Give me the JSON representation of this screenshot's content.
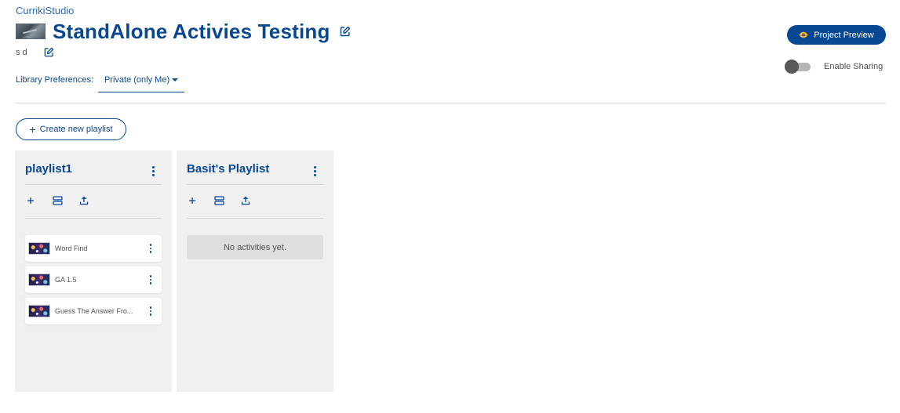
{
  "breadcrumb": "CurrikiStudio",
  "project": {
    "title": "StandAlone Activies Testing",
    "description": "s d"
  },
  "library": {
    "label": "Library Preferences:",
    "selected": "Private (only Me)"
  },
  "preview_button": {
    "label": "Project Preview"
  },
  "sharing": {
    "label": "Enable Sharing",
    "enabled": false
  },
  "create_playlist_button": {
    "label": "Create new playlist"
  },
  "colors": {
    "primary": "#084892",
    "accent": "#f8af2c",
    "panel": "#f0f0f0"
  },
  "playlists": [
    {
      "title": "playlist1",
      "activities": [
        {
          "title": "Word Find"
        },
        {
          "title": "GA 1.5"
        },
        {
          "title": "Guess The Answer Fro..."
        }
      ]
    },
    {
      "title": "Basit's Playlist",
      "empty_text": "No activities yet."
    }
  ]
}
